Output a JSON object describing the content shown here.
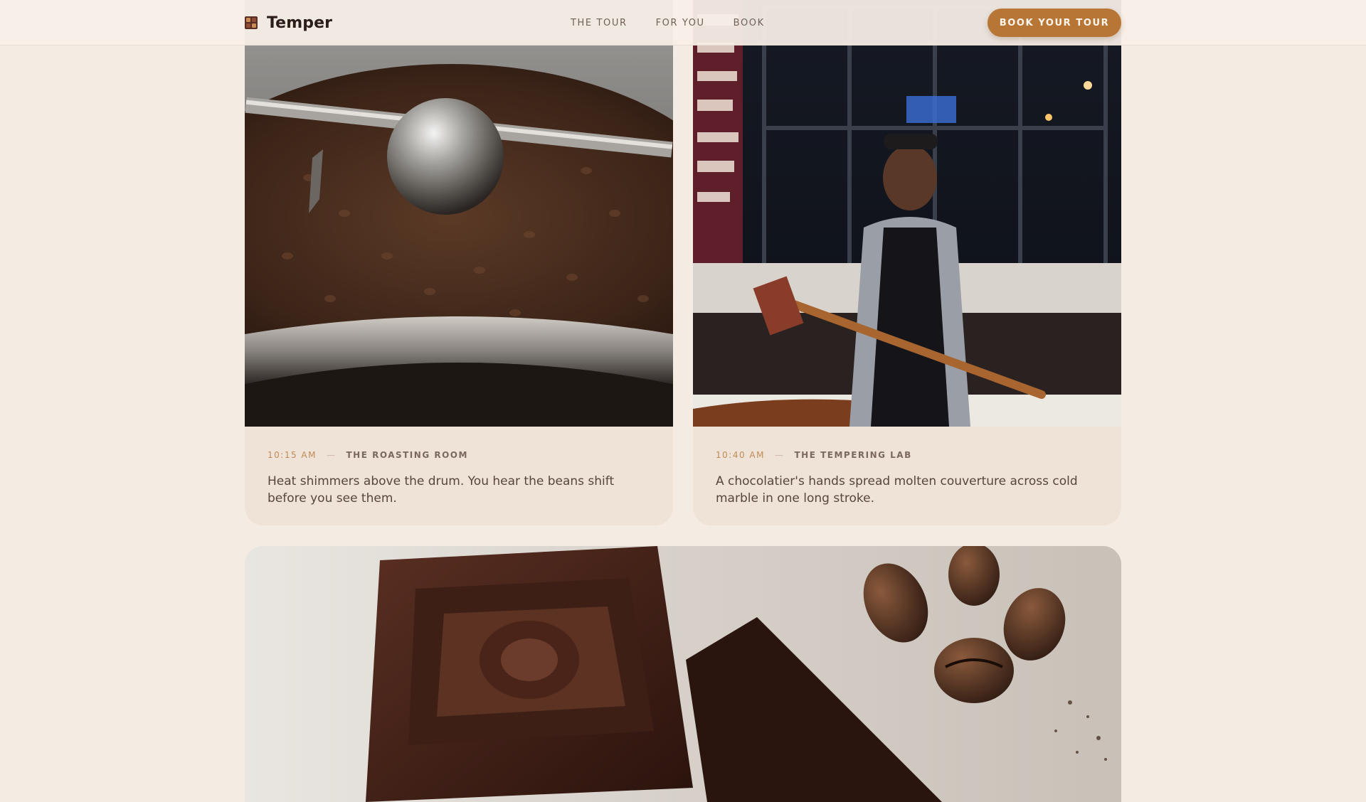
{
  "header": {
    "brand": "Temper",
    "nav": [
      "THE TOUR",
      "FOR YOU",
      "BOOK"
    ],
    "cta": "BOOK YOUR TOUR"
  },
  "stops": [
    {
      "time": "10:15 AM",
      "room": "THE ROASTING ROOM",
      "description": "Heat shimmers above the drum. You hear the beans shift before you see them."
    },
    {
      "time": "10:40 AM",
      "room": "THE TEMPERING LAB",
      "description": "A chocolatier's hands spread molten couverture across cold marble in one long stroke."
    }
  ],
  "colors": {
    "background": "#f4ebe3",
    "card": "#efe2d6",
    "accent": "#b87636",
    "time_label": "#c08b58"
  },
  "icons": {
    "brand": "chocolate-bar-icon"
  }
}
